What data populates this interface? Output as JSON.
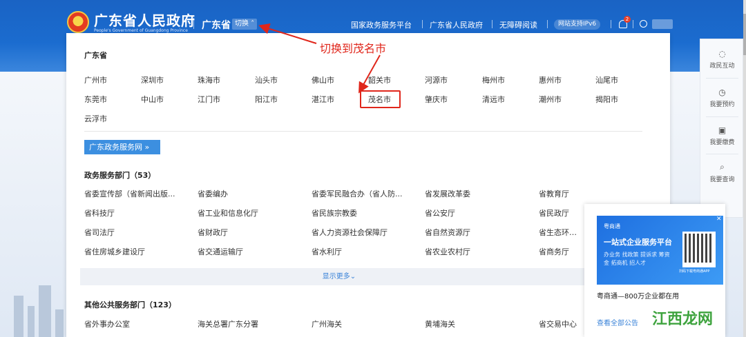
{
  "header": {
    "site_title": "广东省人民政府",
    "site_subtitle": "People's Government of Guangdong Province",
    "province": "广东省",
    "switch_label": "切换",
    "nav": [
      "国家政务服务平台",
      "广东省人民政府",
      "无障碍阅读"
    ],
    "ipv6_label": "网站支持IPv6",
    "notification_count": "2"
  },
  "annotation": "切换到茂名市",
  "region_panel": {
    "province_heading": "广东省",
    "cities": [
      "广州市",
      "深圳市",
      "珠海市",
      "汕头市",
      "佛山市",
      "韶关市",
      "河源市",
      "梅州市",
      "惠州市",
      "汕尾市",
      "东莞市",
      "中山市",
      "江门市",
      "阳江市",
      "湛江市",
      "茂名市",
      "肇庆市",
      "清远市",
      "潮州市",
      "揭阳市",
      "云浮市"
    ],
    "highlighted_city": "茂名市",
    "gd_button_label": "广东政务服务网 »",
    "gov_dept_heading": "政务服务部门（53）",
    "gov_depts": [
      "省委宣传部（省新闻出版...",
      "省委编办",
      "省委军民融合办（省人防...",
      "省发展改革委",
      "省教育厅",
      "省科技厅",
      "省工业和信息化厅",
      "省民族宗教委",
      "省公安厅",
      "省民政厅",
      "省司法厅",
      "省财政厅",
      "省人力资源社会保障厅",
      "省自然资源厅",
      "省生态环境厅",
      "省住房城乡建设厅",
      "省交通运输厅",
      "省水利厅",
      "省农业农村厅",
      "省商务厅"
    ],
    "show_more_label": "显示更多⌄",
    "other_dept_heading": "其他公共服务部门（123）",
    "other_depts": [
      "省外事办公室",
      "海关总署广东分署",
      "广州海关",
      "黄埔海关",
      "省交易中心"
    ]
  },
  "side_toolbar": {
    "items": [
      {
        "label": "政民互动",
        "icon": "chat-icon"
      },
      {
        "label": "我要预约",
        "icon": "clock-icon"
      },
      {
        "label": "我要缴费",
        "icon": "payment-icon"
      },
      {
        "label": "我要查询",
        "icon": "search-icon"
      }
    ]
  },
  "ad": {
    "logo_text": "粤商通",
    "title": "一站式企业服务平台",
    "tags": "办业务  找政策  提诉求  筹资金  拓商机  招人才",
    "qr_caption": "扫码下载粤商通APP",
    "close": "✕",
    "caption": "粤商通—800万企业都在用",
    "link": "查看全部公告"
  },
  "watermark": "江西龙网",
  "colors": {
    "header_blue": "#1b6ccf",
    "accent_red": "#e0261b",
    "link_blue": "#3a83d8"
  }
}
